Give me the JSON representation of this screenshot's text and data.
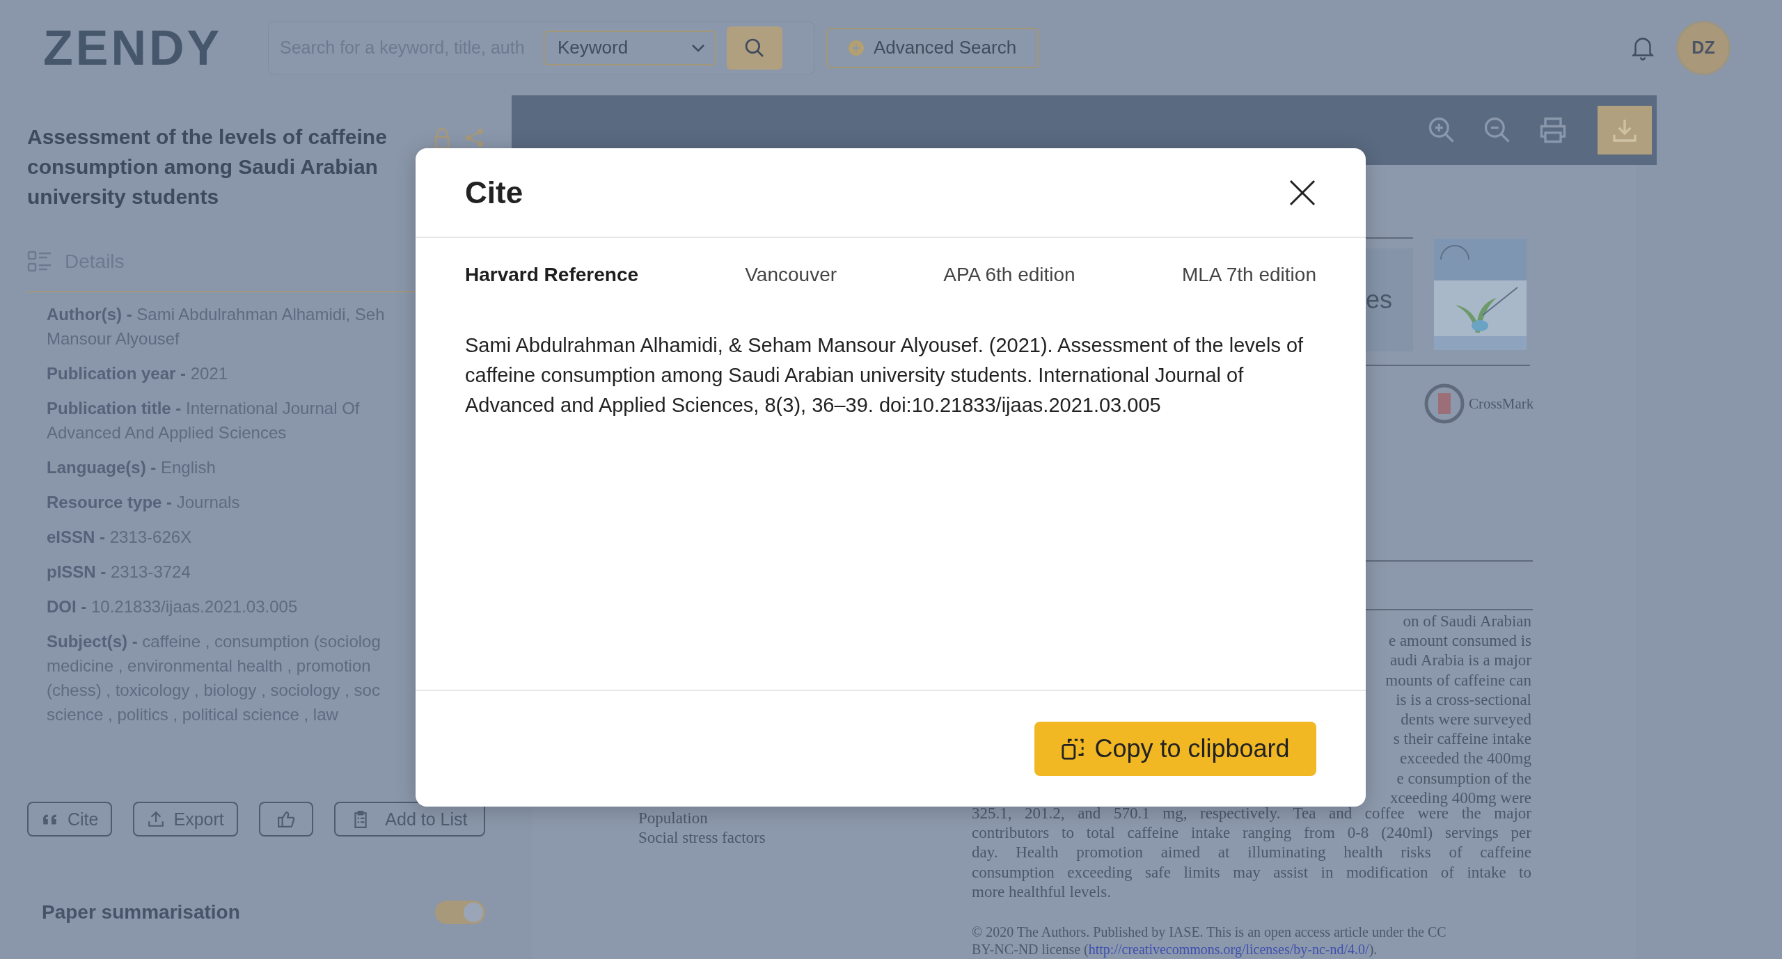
{
  "header": {
    "logo": "ZENDY",
    "search": {
      "placeholder": "Search for a keyword, title, auth"
    },
    "search_type": "Keyword",
    "advanced_search": "Advanced Search",
    "avatar": "DZ"
  },
  "article": {
    "title": "Assessment of the levels of caffeine consumption among Saudi Arabian university students",
    "details_label": "Details",
    "details": [
      {
        "label": "Author(s) -",
        "lines": [
          "Sami Abdulrahman Alhamidi, Seh",
          "Mansour Alyousef"
        ]
      },
      {
        "label": "Publication year -",
        "lines": [
          "2021"
        ]
      },
      {
        "label": "Publication title -",
        "lines": [
          "International Journal Of",
          "Advanced And Applied Sciences"
        ]
      },
      {
        "label": "Language(s) -",
        "lines": [
          "English"
        ]
      },
      {
        "label": "Resource type -",
        "lines": [
          "Journals"
        ]
      },
      {
        "label": "eISSN -",
        "lines": [
          "2313-626X"
        ]
      },
      {
        "label": "pISSN -",
        "lines": [
          "2313-3724"
        ]
      },
      {
        "label": "DOI -",
        "lines": [
          "10.21833/ijaas.2021.03.005"
        ]
      },
      {
        "label": "Subject(s) -",
        "lines": [
          "caffeine , consumption (sociolog",
          "medicine , environmental health , promotion",
          "(chess) , toxicology , biology , sociology , soc",
          "science , politics , political science , law"
        ]
      }
    ],
    "actions": [
      {
        "kind": "cite",
        "label": "Cite"
      },
      {
        "kind": "export",
        "label": "Export"
      },
      {
        "kind": "like"
      },
      {
        "kind": "list",
        "label": "Add to List"
      }
    ],
    "summarisation": {
      "label": "Paper summarisation",
      "on": true
    }
  },
  "viewer": {
    "page": {
      "heading_fragment": "es",
      "crossmark": "CrossMark",
      "abstract_fragments": [
        "on of Saudi Arabian",
        "e amount consumed is",
        "audi Arabia is a major",
        "mounts of caffeine can",
        "is is a cross-sectional",
        "dents were surveyed",
        "s their caffeine intake",
        "exceeded the 400mg",
        "e consumption of the",
        "xceeding 400mg were"
      ],
      "abstract_lines": [
        "325.1, 201.2, and 570.1 mg, respectively. Tea and coffee were the major",
        "contributors to total caffeine intake ranging from 0-8 (240ml) servings per",
        "day. Health promotion aimed at illuminating health risks of caffeine",
        "consumption exceeding safe limits may assist in modification of intake to",
        "more healthful levels."
      ],
      "keywords": [
        "Population",
        "Social stress factors"
      ],
      "license": {
        "line_1": "© 2020 The Authors. Published by IASE. This is an open access article under the CC",
        "before_link": "BY-NC-ND license (",
        "link": "http://creativecommons.org/licenses/by-nc-nd/4.0/",
        "after_link": ")."
      }
    }
  },
  "modal": {
    "title": "Cite",
    "tabs": [
      {
        "label": "Harvard Reference",
        "selected": true
      },
      {
        "label": "Vancouver",
        "selected": false
      },
      {
        "label": "APA 6th edition",
        "selected": false
      },
      {
        "label": "MLA 7th edition",
        "selected": false
      }
    ],
    "citation": "Sami Abdulrahman Alhamidi, & Seham Mansour Alyousef. (2021). Assessment of the levels of caffeine consumption among Saudi Arabian university students. International Journal of Advanced and Applied Sciences, 8(3), 36–39. doi:10.21833/ijaas.2021.03.005",
    "copy_button": "Copy to clipboard"
  }
}
